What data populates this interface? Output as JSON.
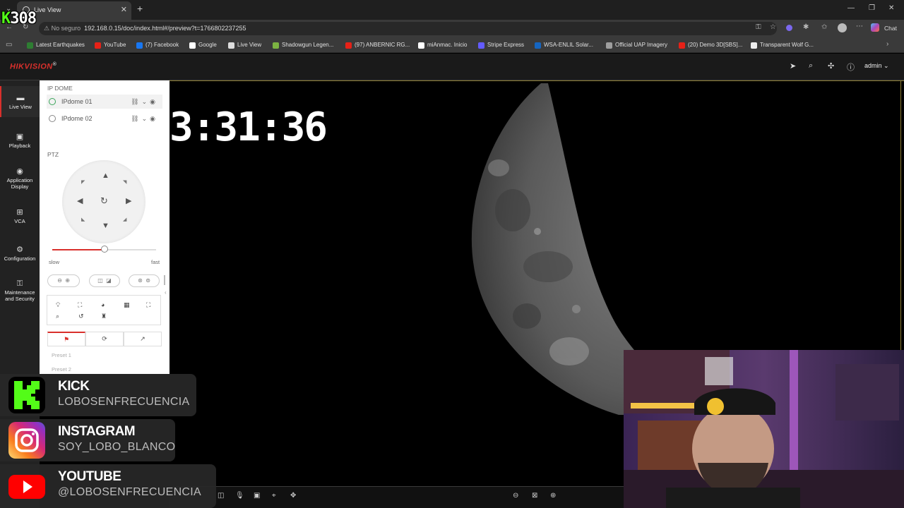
{
  "browser": {
    "tab_title": "Live View",
    "new_tab": "+",
    "url_security": "No seguro",
    "url": "192.168.0.15/doc/index.html#/preview?t=1766802237255",
    "chat_label": "Chat",
    "bookmarks": [
      {
        "label": "Latest Earthquakes",
        "color": "#2e7d32"
      },
      {
        "label": "YouTube",
        "color": "#e62117"
      },
      {
        "label": "(7) Facebook",
        "color": "#1877f2"
      },
      {
        "label": "Google",
        "color": "#ffffff"
      },
      {
        "label": "Live View",
        "color": "#dddddd"
      },
      {
        "label": "Shadowgun Legen...",
        "color": "#7cb342"
      },
      {
        "label": "(97) ANBERNIC RG...",
        "color": "#e62117"
      },
      {
        "label": "miAnmac. Inicio",
        "color": "#ffffff"
      },
      {
        "label": "Stripe Express",
        "color": "#635bff"
      },
      {
        "label": "WSA-ENLIL Solar...",
        "color": "#1565c0"
      },
      {
        "label": "Official UAP Imagery",
        "color": "#9e9e9e"
      },
      {
        "label": "(20) Demo 3D[SBS]...",
        "color": "#e62117"
      },
      {
        "label": "Transparent Wolf G...",
        "color": "#eeeeee"
      }
    ]
  },
  "app": {
    "logo": "HIKVISION",
    "logo_mark": "®",
    "user": "admin",
    "nav": [
      {
        "label": "Live View"
      },
      {
        "label": "Playback"
      },
      {
        "label": "Application Display"
      },
      {
        "label": "VCA"
      },
      {
        "label": "Configuration"
      },
      {
        "label": "Maintenance and Security"
      }
    ],
    "group_title": "IP DOME",
    "cameras": [
      "IPdome 01",
      "IPdome 02"
    ],
    "ptz_title": "PTZ",
    "speed_min": "slow",
    "speed_max": "fast",
    "speed_level": 0.5,
    "presets": [
      "Preset 1",
      "Preset 2"
    ]
  },
  "video": {
    "timestamp": "3:31:36"
  },
  "overlay": {
    "counter_prefix": "K",
    "counter": "308",
    "socials": [
      {
        "title": "KICK",
        "handle": "LOBOSENFRECUENCIA",
        "color": "#53fc18"
      },
      {
        "title": "INSTAGRAM",
        "handle": "SOY_LOBO_BLANCO",
        "color": "#e1306c"
      },
      {
        "title": "YOUTUBE",
        "handle": "@LOBOSENFRECUENCIA",
        "color": "#ff0000"
      }
    ]
  }
}
